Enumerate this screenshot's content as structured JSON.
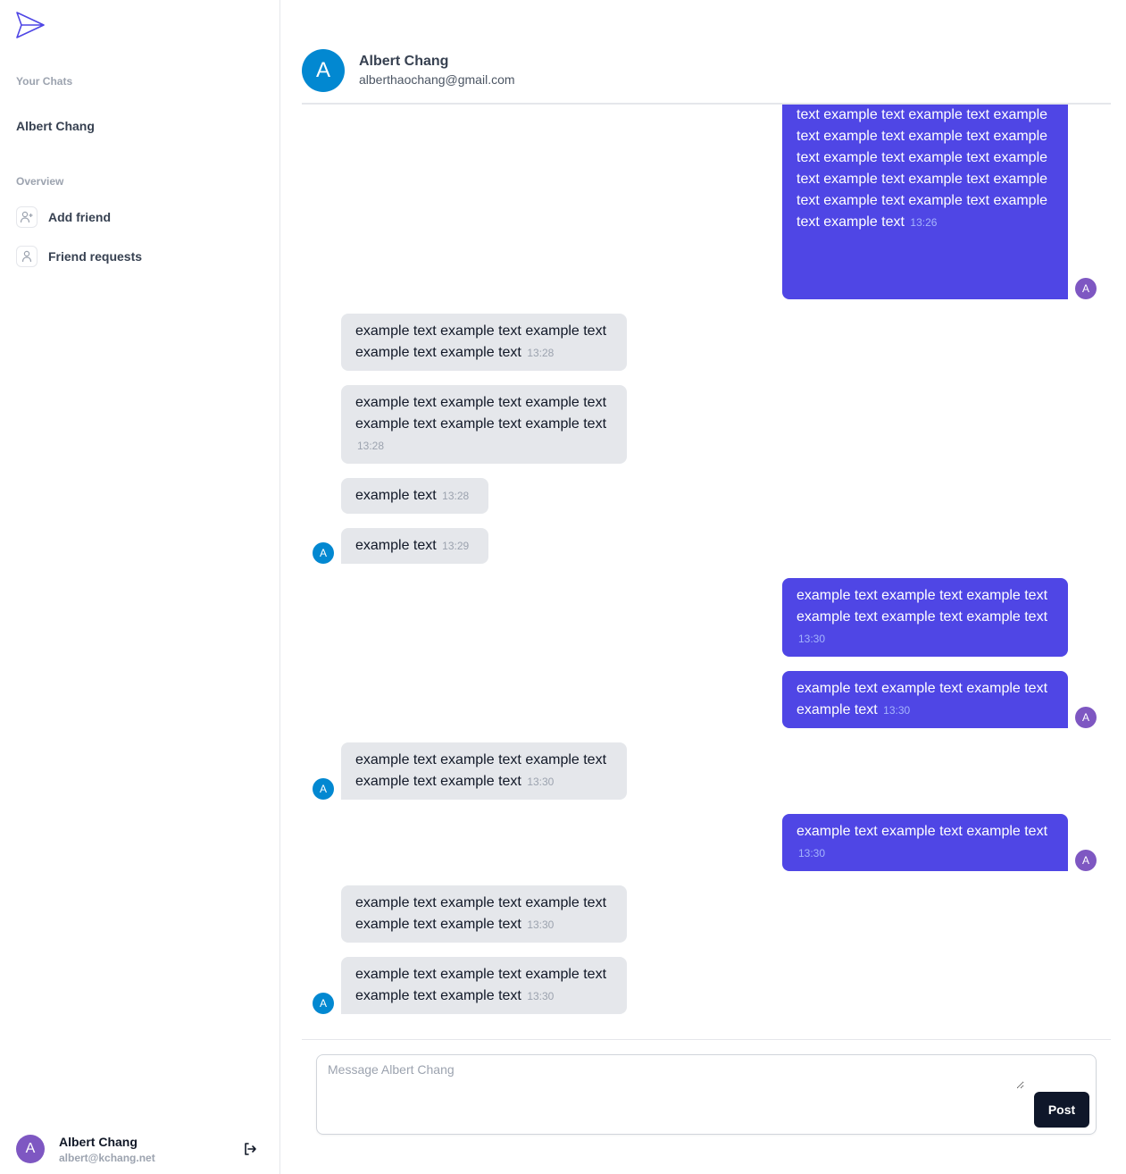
{
  "colors": {
    "accent": "#4f46e5",
    "incoming_bubble": "#e5e7eb",
    "contact_avatar": "#0288d1",
    "self_avatar": "#7e57c2",
    "button": "#0f172a"
  },
  "sidebar": {
    "logo_icon": "paper-plane-icon",
    "your_chats_label": "Your Chats",
    "chats": [
      {
        "name": "Albert Chang"
      }
    ],
    "overview_label": "Overview",
    "nav": [
      {
        "label": "Add friend",
        "icon": "user-plus-icon"
      },
      {
        "label": "Friend requests",
        "icon": "user-icon"
      }
    ],
    "user": {
      "initial": "A",
      "name": "Albert Chang",
      "email": "albert@kchang.net"
    },
    "logout_icon": "logout-icon"
  },
  "chat": {
    "header": {
      "initial": "A",
      "name": "Albert Chang",
      "email": "alberthaochang@gmail.com"
    },
    "messages": [
      {
        "from": "me",
        "text": "text example text example text example text example text example text example text example text example text example text example text example text example text example text example text example text example text",
        "time": "13:26",
        "avatar": "A"
      },
      {
        "from": "them",
        "text": "example text example text example text example text example text",
        "time": "13:28"
      },
      {
        "from": "them",
        "text": "example text example text example text example text example text example text",
        "time": "13:28"
      },
      {
        "from": "them",
        "text": "example text",
        "time": "13:28"
      },
      {
        "from": "them",
        "text": "example text",
        "time": "13:29",
        "avatar": "A"
      },
      {
        "from": "me",
        "text": "example text example text example text example text example text example text",
        "time": "13:30"
      },
      {
        "from": "me",
        "text": "example text example text example text example text",
        "time": "13:30",
        "avatar": "A"
      },
      {
        "from": "them",
        "text": "example text example text example text example text example text",
        "time": "13:30",
        "avatar": "A"
      },
      {
        "from": "me",
        "text": "example text example text example text",
        "time": "13:30",
        "avatar": "A"
      },
      {
        "from": "them",
        "text": "example text example text example text example text example text",
        "time": "13:30"
      },
      {
        "from": "them",
        "text": "example text example text example text example text example text",
        "time": "13:30",
        "avatar": "A"
      }
    ],
    "composer": {
      "placeholder": "Message Albert Chang",
      "post_label": "Post"
    }
  }
}
